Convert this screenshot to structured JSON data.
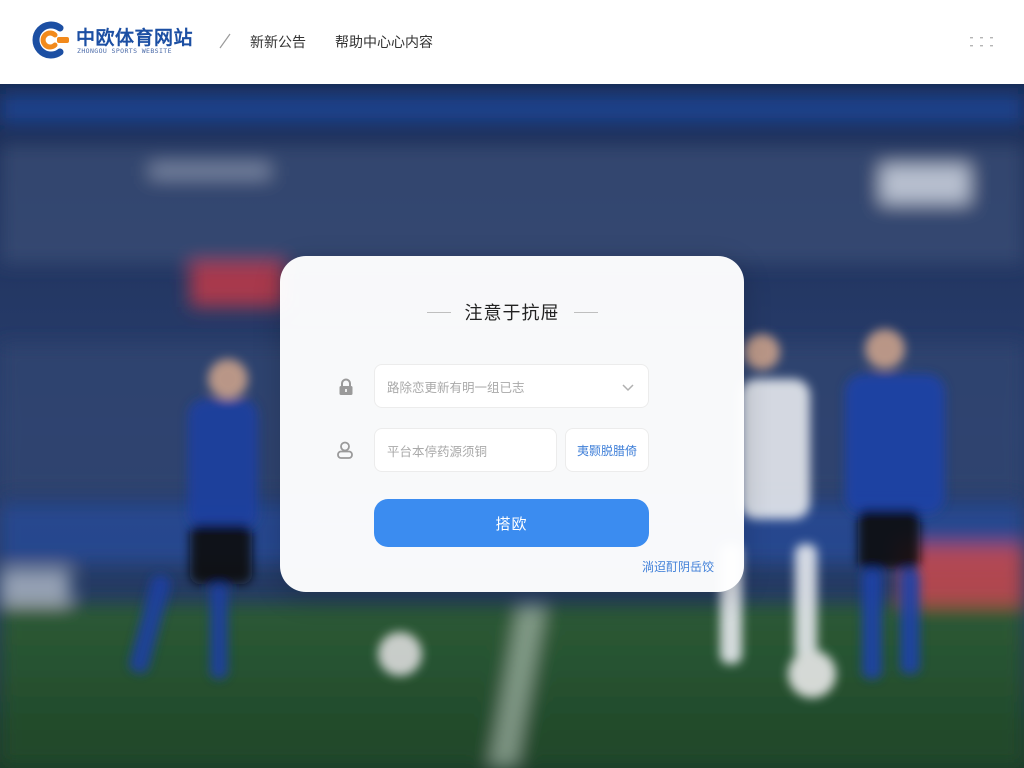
{
  "header": {
    "logo": {
      "title": "中欧体育网站",
      "subtitle": "ZHONGOU SPORTS WEBSITE"
    },
    "nav": [
      {
        "label": "新新公告"
      },
      {
        "label": "帮助中心心内容"
      }
    ],
    "menu_icon": "grid-dots-icon"
  },
  "login": {
    "title": "注意于抗屉",
    "account_select": {
      "placeholder": "路除恋更新有明一组已志",
      "icon": "lock-icon"
    },
    "code_input": {
      "placeholder": "平台本停药源须铜",
      "icon": "user-icon"
    },
    "get_code_label": "夷颢脱腊倚",
    "submit_label": "搭欧",
    "help_link": "淌迢酊阴岳饺"
  },
  "colors": {
    "brand_blue": "#1c4fa3",
    "brand_orange": "#f28a1c",
    "accent": "#3b8cf0",
    "link": "#3f7fd8"
  }
}
